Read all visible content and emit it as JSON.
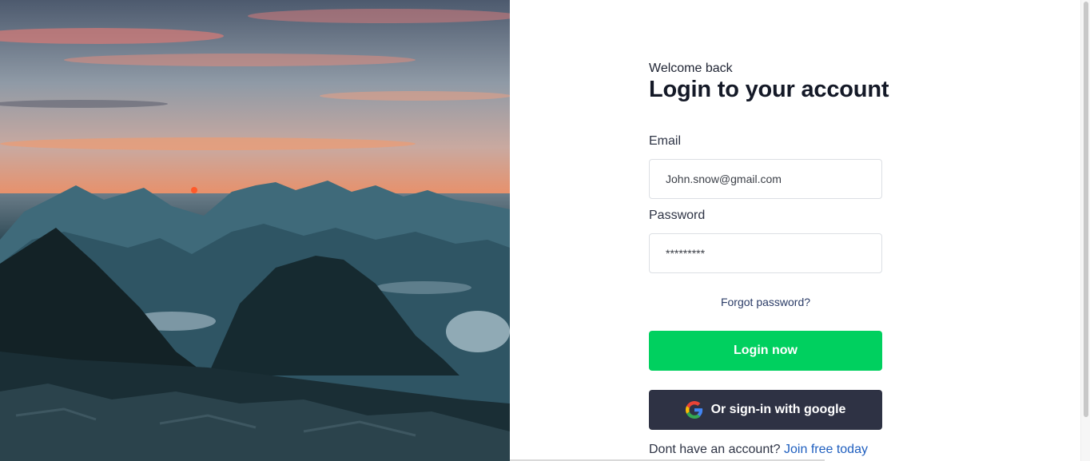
{
  "hero": {
    "image": "mountain-sunset-photo"
  },
  "login": {
    "welcome": "Welcome back",
    "title": "Login to your account",
    "email_label": "Email",
    "email_placeholder": "John.snow@gmail.com",
    "password_label": "Password",
    "password_placeholder": "*********",
    "forgot_link": "Forgot password?",
    "login_button": "Login now",
    "google_button": "Or sign-in with google",
    "signup_prompt": "Dont have an account?",
    "signup_link": "Join free today"
  },
  "colors": {
    "primary_green": "#00d05f",
    "google_button_bg": "#2e3244",
    "link_blue": "#1f5fbf",
    "heading": "#141927"
  },
  "icons": {
    "google": "google-g-logo"
  }
}
